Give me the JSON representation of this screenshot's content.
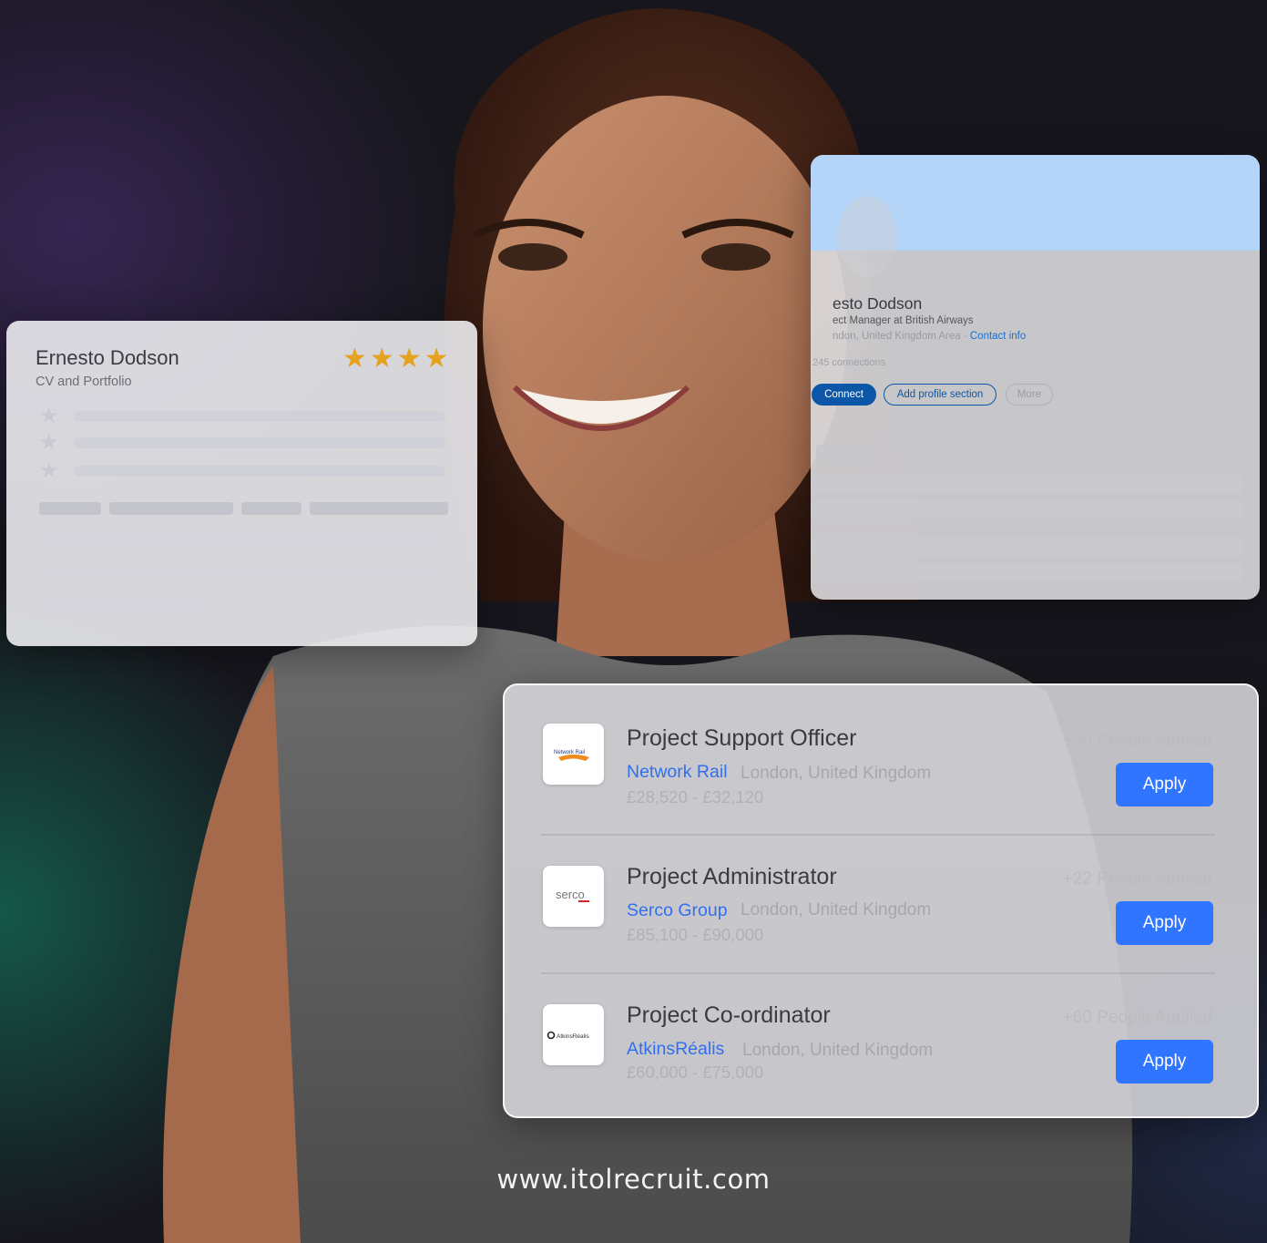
{
  "cv_card": {
    "name": "Ernesto Dodson",
    "subtitle": "CV and Portfolio",
    "rating": 4,
    "rating_text": "★★★★",
    "star_color": "#e6a11f"
  },
  "profile_card": {
    "name": "esto Dodson",
    "headline": "ect Manager at British Airways",
    "location": "ndon, United Kingdom Area · ",
    "contact_link": "Contact info",
    "connections": "245 connections",
    "buttons": {
      "connect": "Connect",
      "add_section": "Add profile section",
      "more": "More"
    },
    "banner_color": "#b5d5f8"
  },
  "jobs": [
    {
      "title": "Project Support Officer",
      "company": "Network Rail",
      "location": "London, United Kingdom",
      "salary": "£28,520 - £32,120",
      "applied": "+50 People Applied",
      "apply_label": "Apply",
      "logo_icon": "network-rail-logo"
    },
    {
      "title": "Project Administrator",
      "company": "Serco Group",
      "location": "London, United Kingdom",
      "salary": "£85,100 - £90,000",
      "applied": "+22 People Applied",
      "apply_label": "Apply",
      "logo_icon": "serco-logo",
      "logo_text": "serco"
    },
    {
      "title": "Project Co-ordinator",
      "company": "AtkinsRéalis",
      "location": "London, United Kingdom",
      "salary": "£60,000 - £75,000",
      "applied": "+60 People Applied",
      "apply_label": "Apply",
      "logo_icon": "atkinsrealis-logo"
    }
  ],
  "footer": {
    "website": "www.itolrecruit.com"
  },
  "colors": {
    "accent": "#2f75ff",
    "link": "#1a6fd1",
    "linkedin_blue": "#0b56a7"
  }
}
